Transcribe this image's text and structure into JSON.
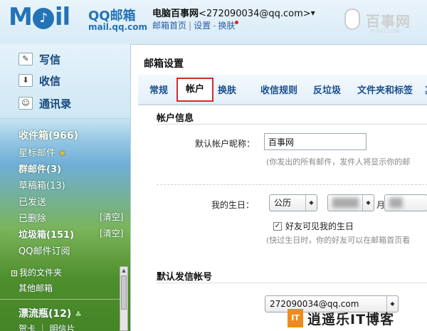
{
  "header": {
    "logo_text": "M  il",
    "logo_brand": "QQ邮箱",
    "logo_url": "mail.qq.com",
    "user_name": "电脑百事网",
    "user_email": "<272090034@qq.com>",
    "links": [
      "邮箱首页",
      "设置",
      "换肤"
    ],
    "watermark": "百事网",
    "watermark_sub": "PC841.COM"
  },
  "sidebar": {
    "actions": [
      {
        "label": "写信",
        "icon": "pencil-icon"
      },
      {
        "label": "收信",
        "icon": "inbox-download-icon"
      },
      {
        "label": "通讯录",
        "icon": "contacts-icon"
      }
    ],
    "folders": {
      "inbox": "收件箱(966)",
      "starred": "星标邮件",
      "groups": "群邮件(3)",
      "drafts": "草稿箱(13)",
      "sent": "已发送",
      "deleted": "已删除",
      "spam": "垃圾箱(151)",
      "subscribe": "QQ邮件订阅",
      "my_folders": "我的文件夹",
      "other_mail": "其他邮箱",
      "drift": "漂流瓶(12)",
      "cards": "贺卡 ｜ 明信片"
    },
    "clear_label": "[清空]"
  },
  "main": {
    "title": "邮箱设置",
    "tabs": [
      "常规",
      "帐户",
      "换肤",
      "收信规则",
      "反垃圾",
      "文件夹和标签",
      "其"
    ],
    "active_tab": "帐户",
    "account_section_title": "帐户信息",
    "nickname_label": "默认帐户昵称：",
    "nickname_value": "百事网",
    "nickname_hint": "(你发出的所有邮件，发件人将显示你的邮",
    "birthday_label": "我的生日：",
    "calendar_type": "公历",
    "year_value": "████",
    "month_label": "月",
    "month_value": "██",
    "friends_visible_label": "好友可见我的生日",
    "birthday_hint": "(快过生日时，你的好友可以在邮箱首页看",
    "sender_section_title": "默认发信帐号",
    "sender_value": "272090034@qq.com"
  },
  "footer_watermark": {
    "badge": "IT",
    "text": "逍遥乐IT博客"
  }
}
